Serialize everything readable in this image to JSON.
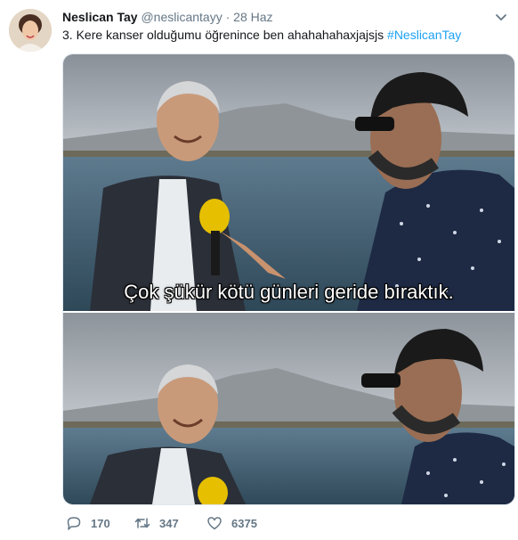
{
  "tweet": {
    "author_name": "Neslican Tay",
    "handle": "@neslicantayy",
    "separator": "·",
    "date": "28 Haz",
    "text": "3. Kere kanser olduğumu öğrenince ben ahahahahaxjajsjs",
    "hashtag": "#NeslicanTay",
    "caption": "Çok şükür kötü günleri geride bıraktık."
  },
  "stats": {
    "replies": "170",
    "retweets": "347",
    "likes": "6375"
  },
  "colors": {
    "accent": "#1da1f2",
    "secondary_text": "#657786",
    "border": "#e1e8ed"
  },
  "icons": [
    "chevron-down-icon",
    "reply-icon",
    "retweet-icon",
    "like-icon"
  ]
}
